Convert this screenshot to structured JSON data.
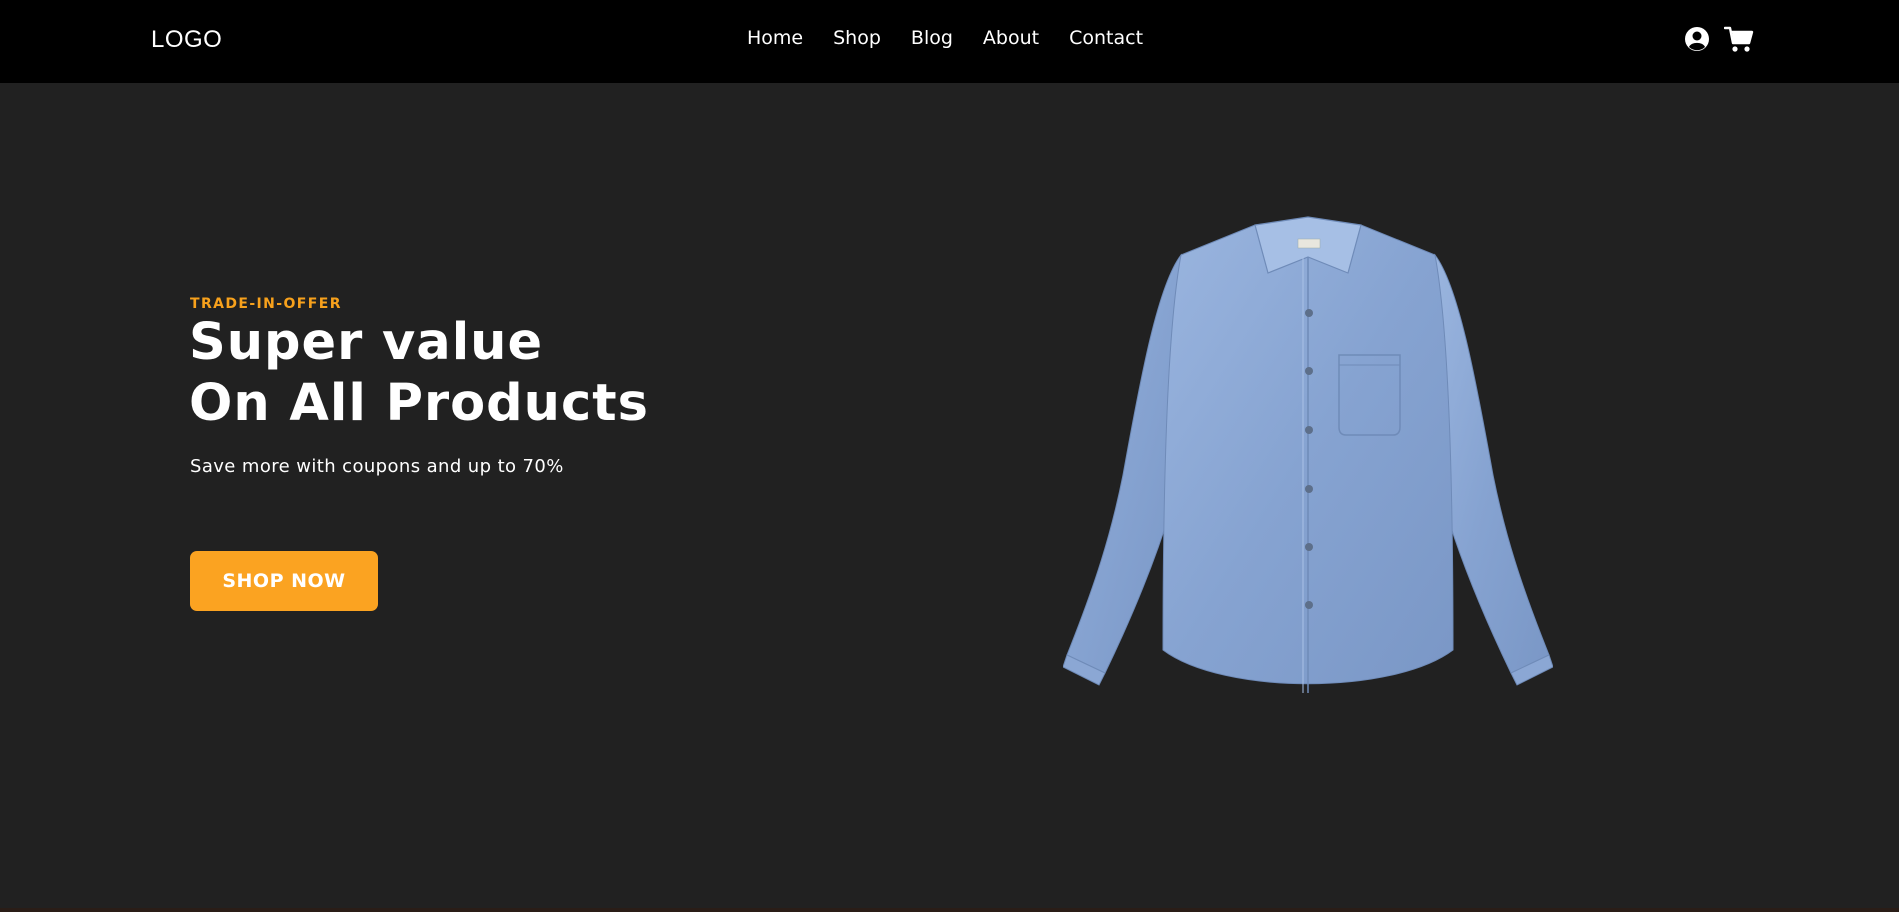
{
  "brand": {
    "logo": "LOGO"
  },
  "nav": {
    "links": [
      "Home",
      "Shop",
      "Blog",
      "About",
      "Contact"
    ],
    "icons": [
      "user-circle-icon",
      "shopping-cart-icon"
    ]
  },
  "hero": {
    "eyebrow": "TRADE-IN-OFFER",
    "title_line1": "Super value",
    "title_line2": "On All Products",
    "subtitle": "Save more with coupons and up to 70%",
    "cta_label": "SHOP NOW",
    "product_image": "blue-denim-shirt"
  },
  "colors": {
    "nav_bg": "#000000",
    "page_bg": "#212121",
    "accent": "#fba321",
    "eyebrow": "#f7a11c",
    "text": "#ffffff",
    "shirt": "#8eaad6"
  }
}
